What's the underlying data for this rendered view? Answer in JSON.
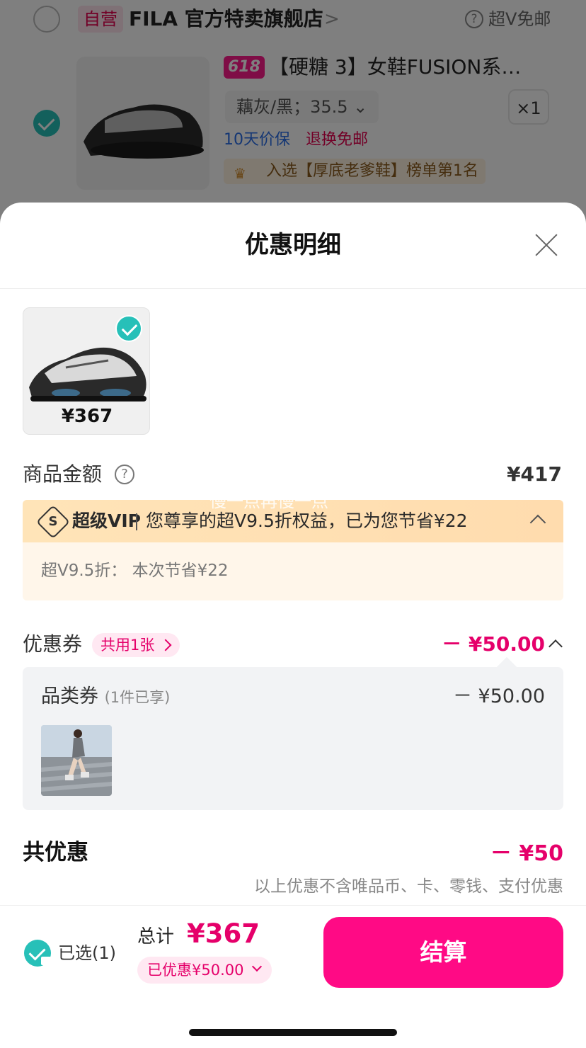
{
  "background": {
    "store_tag": "自营",
    "store_name": "FILA 官方特卖旗舰店",
    "store_chevron": ">",
    "help_glyph": "?",
    "free_shipping": "超V免邮",
    "promo_badge": "618",
    "product_title": "【硬糖 3】女鞋FUSION系…",
    "variant": "藕灰/黑；35.5 ⌄",
    "quantity": "×1",
    "tag_price_protect": "10天价保",
    "tag_free_return": "退换免邮",
    "rank_text": "入选【厚底老爹鞋】榜单第1名"
  },
  "sheet": {
    "title": "优惠明细",
    "product": {
      "price": "¥367"
    },
    "goods_amount": {
      "label": "商品金额",
      "help_glyph": "?",
      "value": "¥417"
    },
    "vip": {
      "icon_glyph": "S",
      "label": "超级VIP",
      "text": "您尊享的超V9.5折权益，已为您节省¥22",
      "detail": "超V9.5折：  本次节省¥22"
    },
    "watermark": "慢一点再慢一点",
    "coupon": {
      "label": "优惠券",
      "pill": "共用1张",
      "value": "－ ¥50.00",
      "category_label": "品类券",
      "category_sub": "(1件已享)",
      "category_value": "－ ¥50.00"
    },
    "total": {
      "label": "共优惠",
      "value": "－ ¥50",
      "note": "以上优惠不含唯品币、卡、零钱、支付优惠"
    }
  },
  "bottom": {
    "selected_label": "已选(1)",
    "sum_label": "总计",
    "sum_value": "¥367",
    "saved_pill": "已优惠¥50.00",
    "checkout_label": "结算"
  },
  "colors": {
    "accent": "#e5006a",
    "checkout": "#ff0a85",
    "check": "#27c0b8",
    "vip_bg": "#ffe4b8"
  }
}
